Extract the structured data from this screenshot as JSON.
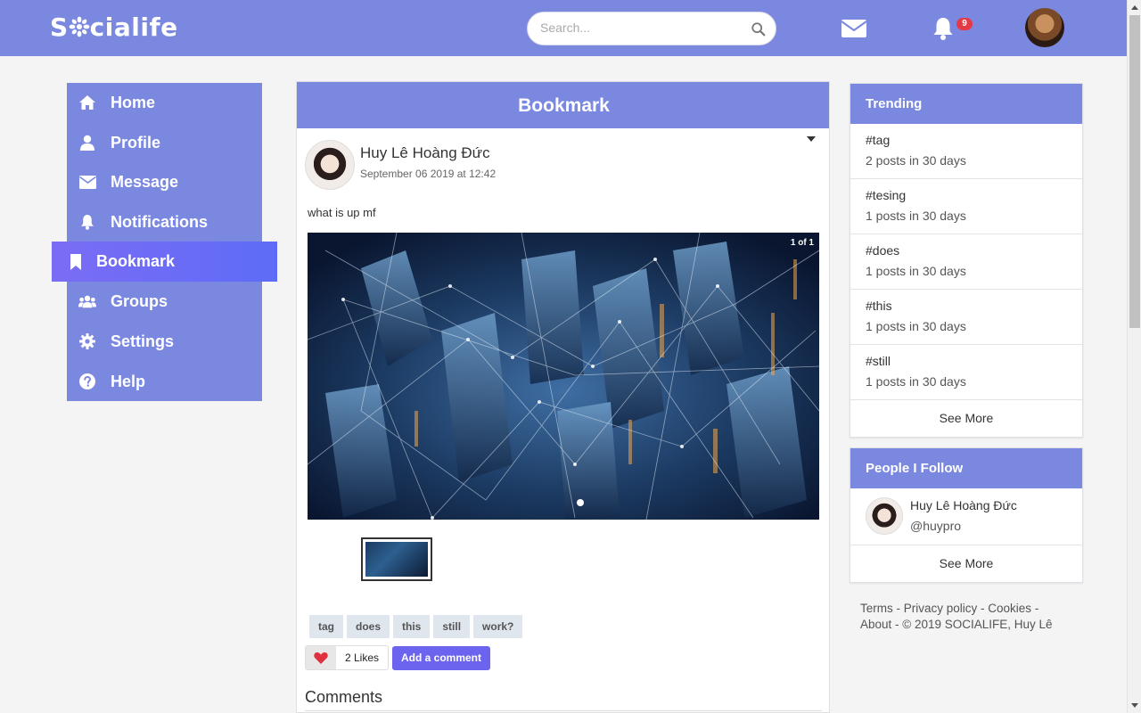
{
  "app": {
    "logo": "Socialife"
  },
  "header": {
    "search_placeholder": "Search...",
    "notification_count": "9"
  },
  "sidebar": {
    "items": [
      {
        "label": "Home",
        "icon": "home-icon"
      },
      {
        "label": "Profile",
        "icon": "user-icon"
      },
      {
        "label": "Message",
        "icon": "envelope-icon"
      },
      {
        "label": "Notifications",
        "icon": "bell-icon"
      },
      {
        "label": "Bookmark",
        "icon": "bookmark-icon",
        "active": true
      },
      {
        "label": "Groups",
        "icon": "users-icon"
      },
      {
        "label": "Settings",
        "icon": "gear-icon"
      },
      {
        "label": "Help",
        "icon": "question-circle-icon"
      }
    ]
  },
  "main": {
    "title": "Bookmark",
    "post": {
      "author": "Huy Lê Hoàng Đức",
      "date": "September 06 2019 at 12:42",
      "text": "what is up mf",
      "image_counter": "1 of 1",
      "tags": [
        "tag",
        "does",
        "this",
        "still",
        "work?"
      ],
      "likes_label": "2 Likes",
      "add_comment_label": "Add a comment"
    },
    "comments_title": "Comments"
  },
  "trending": {
    "title": "Trending",
    "items": [
      {
        "tag": "#tag",
        "count": "2 posts in 30 days"
      },
      {
        "tag": "#tesing",
        "count": "1 posts in 30 days"
      },
      {
        "tag": "#does",
        "count": "1 posts in 30 days"
      },
      {
        "tag": "#this",
        "count": "1 posts in 30 days"
      },
      {
        "tag": "#still",
        "count": "1 posts in 30 days"
      }
    ],
    "see_more": "See More"
  },
  "follow": {
    "title": "People I Follow",
    "people": [
      {
        "name": "Huy Lê Hoàng Đức",
        "handle": "@huypro"
      }
    ],
    "see_more": "See More"
  },
  "footer": {
    "terms": "Terms",
    "privacy": "Privacy policy",
    "cookies": "Cookies",
    "about": "About",
    "sep": " - ",
    "copyright": "© 2019 SOCIALIFE, Huy Lê"
  },
  "colors": {
    "primary": "#7a88e0",
    "active_nav": "#6c63ee",
    "badge": "#e53945",
    "like_heart": "#e0323e"
  }
}
